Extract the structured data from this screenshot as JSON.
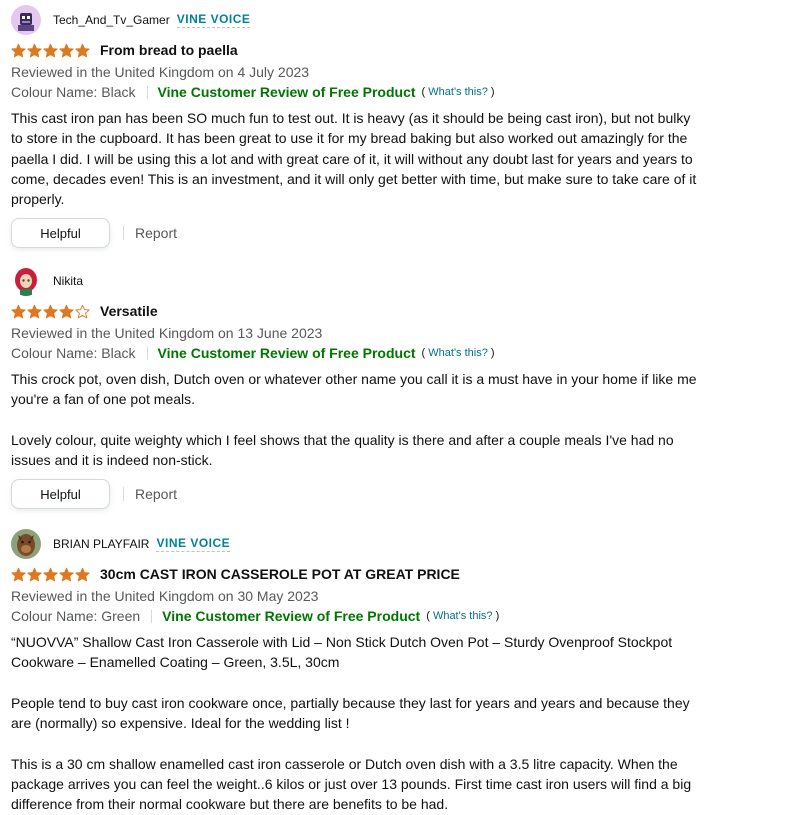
{
  "reviews": [
    {
      "profile_name": "Tech_And_Tv_Gamer",
      "badge": "VINE VOICE",
      "rating": 5,
      "title": "From bread to paella",
      "reviewed_in": "Reviewed in the United Kingdom on 4 July 2023",
      "colour": "Colour Name: Black",
      "vine_label": "Vine Customer Review of Free Product",
      "whats_this": "What's this?",
      "body": "This cast iron pan has been SO much fun to test out. It is heavy (as it should be being cast iron), but not bulky to store in the cupboard. It has been great to use it for my bread baking but also worked out amazingly for the paella I did. I will be using this a lot and with great care of it, it will without any doubt last for years and years to come, decades even! This is an investment, and it will only get better with time, but make sure to take care of it properly.",
      "helpful_label": "Helpful",
      "report_label": "Report"
    },
    {
      "profile_name": "Nikita",
      "badge": "",
      "rating": 4,
      "title": "Versatile",
      "reviewed_in": "Reviewed in the United Kingdom on 13 June 2023",
      "colour": "Colour Name: Black",
      "vine_label": "Vine Customer Review of Free Product",
      "whats_this": "What's this?",
      "body": "This crock pot, oven dish, Dutch oven or whatever other name you call it is a must have in your home if like me you're a fan of one pot meals.\n\nLovely colour, quite weighty which I feel shows that the quality is there and after a couple meals I've had no issues and it is indeed non-stick.",
      "helpful_label": "Helpful",
      "report_label": "Report"
    },
    {
      "profile_name": "BRIAN PLAYFAIR",
      "badge": "VINE VOICE",
      "rating": 5,
      "title": "30cm CAST IRON CASSEROLE POT AT GREAT PRICE",
      "reviewed_in": "Reviewed in the United Kingdom on 30 May 2023",
      "colour": "Colour Name: Green",
      "vine_label": "Vine Customer Review of Free Product",
      "whats_this": "What's this?",
      "body": "“NUOVVA” Shallow Cast Iron Casserole with Lid – Non Stick Dutch Oven Pot – Sturdy Ovenproof Stockpot Cookware – Enamelled Coating – Green, 3.5L, 30cm\n\nPeople tend to buy cast iron cookware once, partially because they last for years and years and because they are (normally) so expensive. Ideal for the wedding list !\n\nThis is a 30 cm shallow enamelled cast iron casserole or Dutch oven dish with a 3.5 litre capacity. When the package arrives you can feel the weight..6 kilos or just over 13 pounds. First time cast iron users will find a big difference from their normal cookware but there are benefits to be had."
    }
  ],
  "colors": {
    "star": "#de7921",
    "vine_green": "#007600",
    "badge_teal": "#008296",
    "link": "#007185"
  }
}
